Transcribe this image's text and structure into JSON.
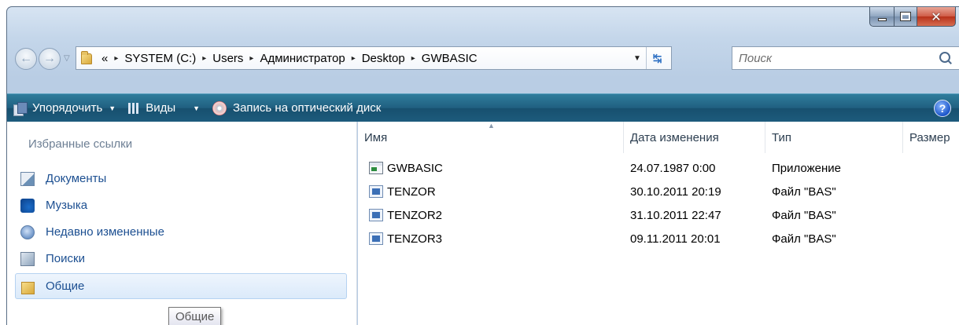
{
  "window": {
    "caption_buttons": {
      "minimize": "minimize-icon",
      "maximize": "maximize-icon",
      "close": "close-icon"
    }
  },
  "nav": {
    "back_icon": "back-arrow-icon",
    "forward_icon": "forward-arrow-icon"
  },
  "address": {
    "overflow": "«",
    "segments": [
      "SYSTEM (C:)",
      "Users",
      "Администратор",
      "Desktop",
      "GWBASIC"
    ],
    "separator": "▸"
  },
  "search": {
    "placeholder": "Поиск"
  },
  "toolbar": {
    "organize_label": "Упорядочить",
    "views_label": "Виды",
    "burn_label": "Запись на оптический диск",
    "help": "?"
  },
  "navpane": {
    "header": "Избранные ссылки",
    "items": [
      {
        "label": "Документы",
        "icon": "documents-icon"
      },
      {
        "label": "Музыка",
        "icon": "music-icon"
      },
      {
        "label": "Недавно измененные",
        "icon": "recent-changes-icon"
      },
      {
        "label": "Поиски",
        "icon": "searches-icon"
      },
      {
        "label": "Общие",
        "icon": "public-folder-icon"
      }
    ],
    "selected_index": 4,
    "tooltip": "Общие"
  },
  "content": {
    "columns": [
      "Имя",
      "Дата изменения",
      "Тип",
      "Размер"
    ],
    "files": [
      {
        "name": "GWBASIC",
        "date": "24.07.1987 0:00",
        "type": "Приложение",
        "icon": "application-icon"
      },
      {
        "name": "TENZOR",
        "date": "30.10.2011 20:19",
        "type": "Файл \"BAS\"",
        "icon": "bas-file-icon"
      },
      {
        "name": "TENZOR2",
        "date": "31.10.2011 22:47",
        "type": "Файл \"BAS\"",
        "icon": "bas-file-icon"
      },
      {
        "name": "TENZOR3",
        "date": "09.11.2011 20:01",
        "type": "Файл \"BAS\"",
        "icon": "bas-file-icon"
      }
    ]
  }
}
